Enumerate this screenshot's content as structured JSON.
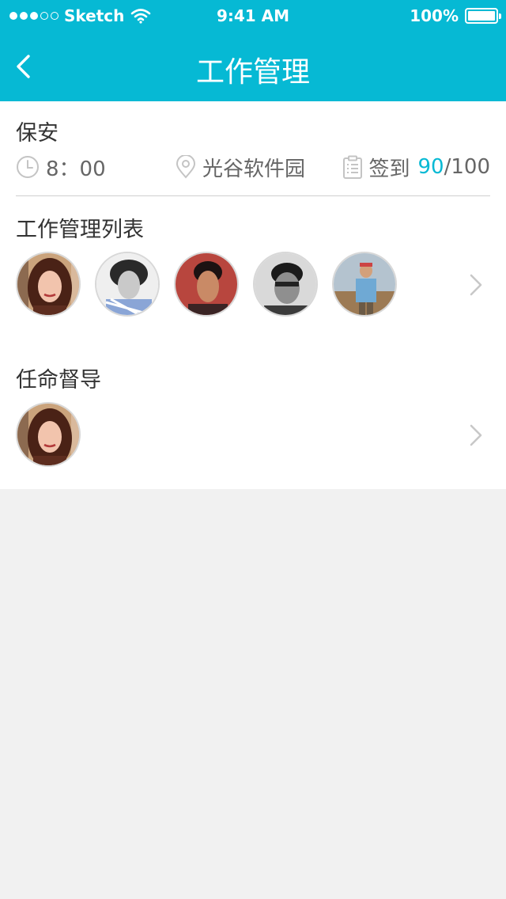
{
  "status_bar": {
    "carrier": "Sketch",
    "time": "9:41 AM",
    "battery": "100%"
  },
  "nav": {
    "title": "工作管理",
    "back_icon": "chevron-left-icon"
  },
  "job": {
    "title": "保安",
    "time": "8：00",
    "location": "光谷软件园",
    "checkin_label": "签到",
    "checkin_count": "90",
    "checkin_total": "/100"
  },
  "sections": {
    "work_list_title": "工作管理列表",
    "supervisor_title": "任命督导"
  },
  "colors": {
    "brand": "#06b9d4",
    "background": "#f1f1f1"
  },
  "icons": [
    "clock-icon",
    "location-pin-icon",
    "clipboard-icon",
    "chevron-right-icon"
  ]
}
